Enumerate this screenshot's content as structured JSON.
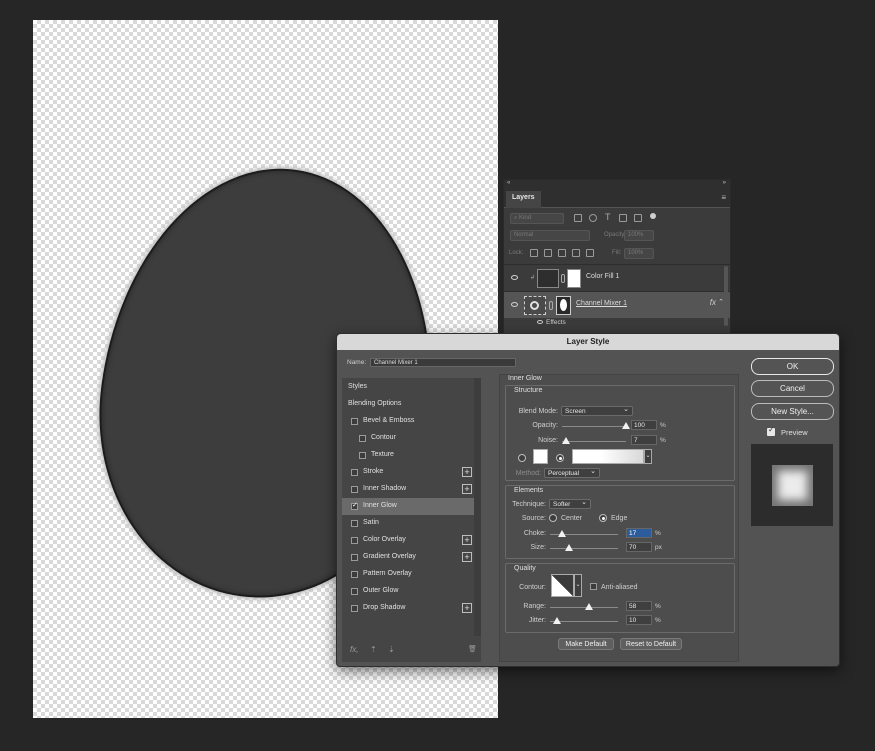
{
  "layers_panel": {
    "top_left_glyph": "«",
    "top_right_glyph": "»",
    "tab": "Layers",
    "menu_glyph": "≡",
    "filter_placeholder": "Kind",
    "blend_mode": "Normal",
    "opacity_label": "Opacity:",
    "opacity_value": "100%",
    "lock_label": "Lock:",
    "fill_label": "Fill:",
    "fill_value": "100%",
    "layers": [
      {
        "name": "Color Fill 1",
        "selected": false
      },
      {
        "name": "Channel Mixer 1",
        "selected": true,
        "fx": "fx"
      }
    ],
    "effects_label": "Effects"
  },
  "dialog": {
    "title": "Layer Style",
    "name_label": "Name:",
    "name_value": "Channel Mixer 1",
    "styles_list": [
      {
        "label": "Styles",
        "checkbox": false,
        "plus": false,
        "indent": 0
      },
      {
        "label": "Blending Options",
        "checkbox": false,
        "plus": false,
        "indent": 0
      },
      {
        "label": "Bevel & Emboss",
        "checkbox": true,
        "checked": false,
        "plus": false,
        "indent": 0
      },
      {
        "label": "Contour",
        "checkbox": true,
        "checked": false,
        "plus": false,
        "indent": 1
      },
      {
        "label": "Texture",
        "checkbox": true,
        "checked": false,
        "plus": false,
        "indent": 1
      },
      {
        "label": "Stroke",
        "checkbox": true,
        "checked": false,
        "plus": true,
        "indent": 0
      },
      {
        "label": "Inner Shadow",
        "checkbox": true,
        "checked": false,
        "plus": true,
        "indent": 0
      },
      {
        "label": "Inner Glow",
        "checkbox": true,
        "checked": true,
        "plus": false,
        "indent": 0,
        "selected": true
      },
      {
        "label": "Satin",
        "checkbox": true,
        "checked": false,
        "plus": false,
        "indent": 0
      },
      {
        "label": "Color Overlay",
        "checkbox": true,
        "checked": false,
        "plus": true,
        "indent": 0
      },
      {
        "label": "Gradient Overlay",
        "checkbox": true,
        "checked": false,
        "plus": true,
        "indent": 0
      },
      {
        "label": "Pattern Overlay",
        "checkbox": true,
        "checked": false,
        "plus": false,
        "indent": 0
      },
      {
        "label": "Outer Glow",
        "checkbox": true,
        "checked": false,
        "plus": false,
        "indent": 0
      },
      {
        "label": "Drop Shadow",
        "checkbox": true,
        "checked": false,
        "plus": true,
        "indent": 0
      }
    ],
    "bottom_fx": "fx,",
    "bottom_up": "⇡",
    "bottom_down": "⇣",
    "bottom_trash": "🗑",
    "section_title": "Inner Glow",
    "structure": {
      "title": "Structure",
      "blend_mode_label": "Blend Mode:",
      "blend_mode": "Screen",
      "opacity_label": "Opacity:",
      "opacity": "100",
      "opacity_pct": 100,
      "noise_label": "Noise:",
      "noise": "7",
      "noise_pct": 7,
      "method_label": "Method:",
      "method": "Perceptual",
      "pct": "%"
    },
    "elements": {
      "title": "Elements",
      "technique_label": "Technique:",
      "technique": "Softer",
      "source_label": "Source:",
      "source_center": "Center",
      "source_edge": "Edge",
      "source_selected": "Edge",
      "choke_label": "Choke:",
      "choke": "17",
      "choke_pct": 17,
      "size_label": "Size:",
      "size": "70",
      "size_pct": 28,
      "size_unit": "px",
      "pct": "%"
    },
    "quality": {
      "title": "Quality",
      "contour_label": "Contour:",
      "anti_aliased_label": "Anti-aliased",
      "anti_aliased": false,
      "range_label": "Range:",
      "range": "58",
      "range_pct": 58,
      "jitter_label": "Jitter:",
      "jitter": "10",
      "jitter_pct": 10,
      "pct": "%"
    },
    "make_default": "Make Default",
    "reset_default": "Reset to Default",
    "ok": "OK",
    "cancel": "Cancel",
    "new_style": "New Style...",
    "preview_label": "Preview",
    "preview_checked": true,
    "check_glyph": "✓"
  }
}
